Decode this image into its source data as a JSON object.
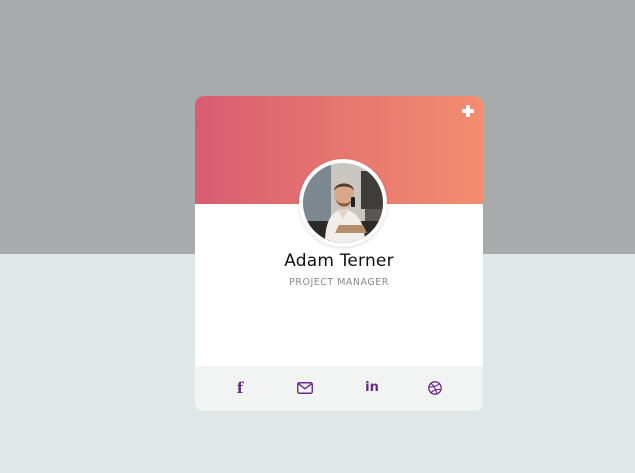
{
  "profile": {
    "name": "Adam Terner",
    "role": "PROJECT MANAGER"
  },
  "icons": {
    "add": "plus-icon",
    "social": [
      "facebook-icon",
      "mail-icon",
      "linkedin-icon",
      "dribbble-icon"
    ]
  },
  "social_labels": {
    "facebook": "f",
    "linkedin": "in"
  },
  "colors": {
    "header_gradient_start": "#d95b72",
    "header_gradient_end": "#f38c70",
    "icon_color": "#6b2a86",
    "page_top": "#a7abac",
    "page_bottom": "#e0e7e8"
  }
}
